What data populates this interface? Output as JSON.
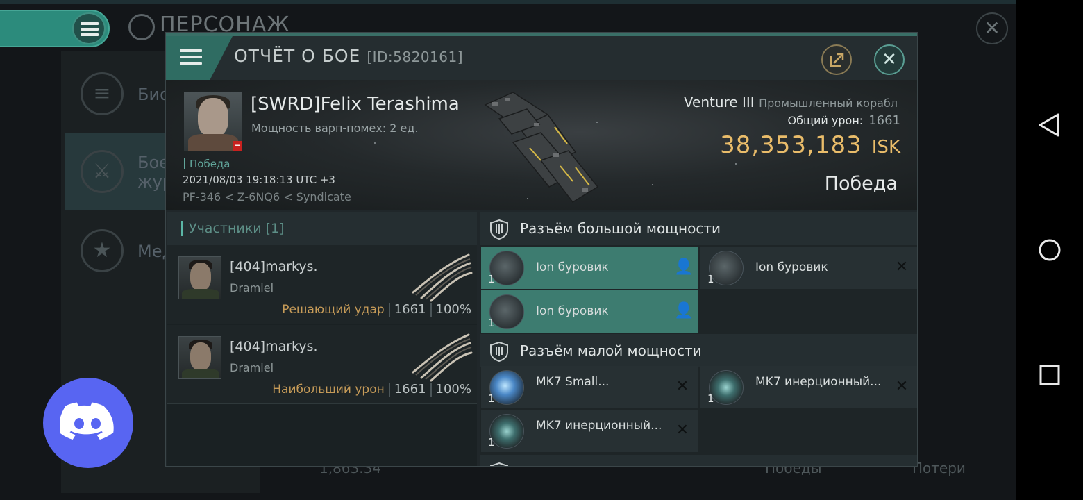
{
  "background": {
    "window_title": "ПЕРСОНАЖ",
    "sidebar": [
      {
        "label": "Био",
        "icon": "list-icon"
      },
      {
        "label": "Боев журн",
        "icon": "crossed-swords-icon"
      },
      {
        "label": "Мед",
        "icon": "star-hexagon-icon"
      }
    ],
    "bottom": {
      "balance": "1,863.34",
      "wins_label": "Победы",
      "losses_label": "Потери"
    }
  },
  "dialog": {
    "title": "ОТЧЁТ О БОЕ",
    "report_id": "[ID:5820161]",
    "victim": {
      "name": "[SWRD]Felix Terashima",
      "warp_disruption": "Мощность варп-помех: 2 ед.",
      "result_tag": "Победа",
      "datetime": "2021/08/03 19:18:13 UTC +3",
      "location": "PF-346 < Z-6NQ6 < Syndicate",
      "ship_name": "Venture III",
      "ship_class": "Промышленный корабл",
      "total_damage_label": "Общий урон:",
      "total_damage": "1661",
      "isk_value": "38,353,183",
      "isk_unit": "ISK",
      "result": "Победа"
    },
    "participants": {
      "header": "Участники [1]",
      "items": [
        {
          "name": "[404]markys.",
          "ship": "Dramiel",
          "role": "Решающий удар",
          "damage": "1661",
          "percent": "100%"
        },
        {
          "name": "[404]markys.",
          "ship": "Dramiel",
          "role": "Наибольший урон",
          "damage": "1661",
          "percent": "100%"
        }
      ]
    },
    "fitting": {
      "high_slots_title": "Разъём большой мощности",
      "high_slots": [
        {
          "name": "Ion буровик",
          "qty": "1",
          "state": "online"
        },
        {
          "name": "Ion буровик",
          "qty": "1",
          "state": "destroyed"
        },
        {
          "name": "Ion буровик",
          "qty": "1",
          "state": "online"
        }
      ],
      "low_slots_title": "Разъём малой мощности",
      "low_slots": [
        {
          "name": "MK7 Small...",
          "qty": "1",
          "state": "destroyed"
        },
        {
          "name": "MK7 инерционный...",
          "qty": "1",
          "state": "destroyed"
        },
        {
          "name": "MK7 инерционный...",
          "qty": "1",
          "state": "destroyed"
        }
      ]
    }
  },
  "colors": {
    "accent": "#3d7c70",
    "isk": "#e9bc6a",
    "role": "#c69b58",
    "discord": "#5865f2"
  }
}
